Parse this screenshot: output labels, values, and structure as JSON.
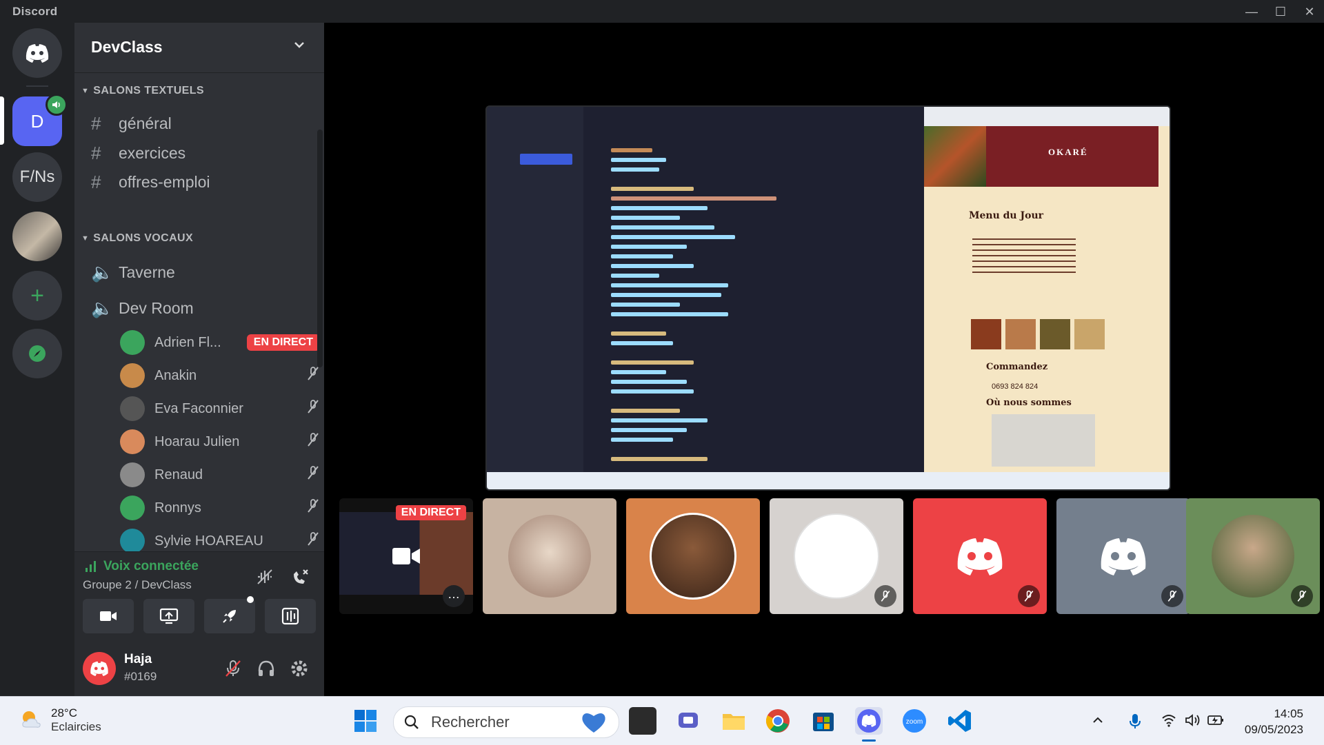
{
  "app": {
    "title": "Discord",
    "window_buttons": [
      "minimize",
      "maximize",
      "close"
    ]
  },
  "servers": [
    {
      "name": "discord-home-icon"
    },
    {
      "label": "D",
      "active": true
    },
    {
      "label": "F/Ns"
    },
    {
      "name": "server-image"
    },
    {
      "name": "add-server-icon"
    },
    {
      "name": "explore-icon"
    }
  ],
  "guild": {
    "name": "DevClass"
  },
  "categories": {
    "text": "SALONS TEXTUELS",
    "voice": "SALONS VOCAUX"
  },
  "text_channels": [
    {
      "label": "général",
      "icon": "hash"
    },
    {
      "label": "exercices",
      "icon": "hash-thread"
    },
    {
      "label": "offres-emploi",
      "icon": "hash"
    }
  ],
  "voice_channels": [
    {
      "label": "Taverne"
    },
    {
      "label": "Dev Room"
    }
  ],
  "voice_users": [
    {
      "name": "Adrien Fl...",
      "badge": "EN DIRECT"
    },
    {
      "name": "Anakin"
    },
    {
      "name": "Eva Faconnier"
    },
    {
      "name": "Hoarau Julien"
    },
    {
      "name": "Renaud"
    },
    {
      "name": "Ronnys"
    },
    {
      "name": "Sylvie HOAREAU"
    }
  ],
  "voice_status": {
    "title": "Voix connectée",
    "subtitle": "Groupe 2 / DevClass"
  },
  "voice_buttons": [
    "camera-icon",
    "screen-share-icon",
    "activity-rocket-icon",
    "soundboard-icon"
  ],
  "user": {
    "name": "Haja",
    "tag": "#0169"
  },
  "stream": {
    "web_title": "OKARÉ",
    "web_menu": "Menu du Jour",
    "web_order": "Commandez",
    "web_phone": "0693 824 824",
    "web_where": "Où nous sommes"
  },
  "tiles": [
    {
      "name": "self-stream",
      "live": "EN DIRECT"
    },
    {
      "name": "kitten-avatar",
      "color": "#c7b3a2"
    },
    {
      "name": "man-avatar",
      "color": "#d9834a"
    },
    {
      "name": "mickey-avatar",
      "color": "#d6d2cf",
      "muted": true
    },
    {
      "name": "discord-red-avatar",
      "color": "#ed4245",
      "muted": true
    },
    {
      "name": "discord-gray-avatar",
      "color": "#747f8d",
      "muted": true
    },
    {
      "name": "elder-avatar",
      "color": "#6b8e5a",
      "muted": true
    }
  ],
  "taskbar": {
    "weather_temp": "28°C",
    "weather_desc": "Eclaircies",
    "search_placeholder": "Rechercher",
    "time": "14:05",
    "date": "09/05/2023"
  },
  "colors": {
    "blurple": "#5865f2",
    "green": "#3ba55d",
    "red": "#ed4245",
    "sidebar": "#2f3136",
    "rail": "#202225"
  }
}
